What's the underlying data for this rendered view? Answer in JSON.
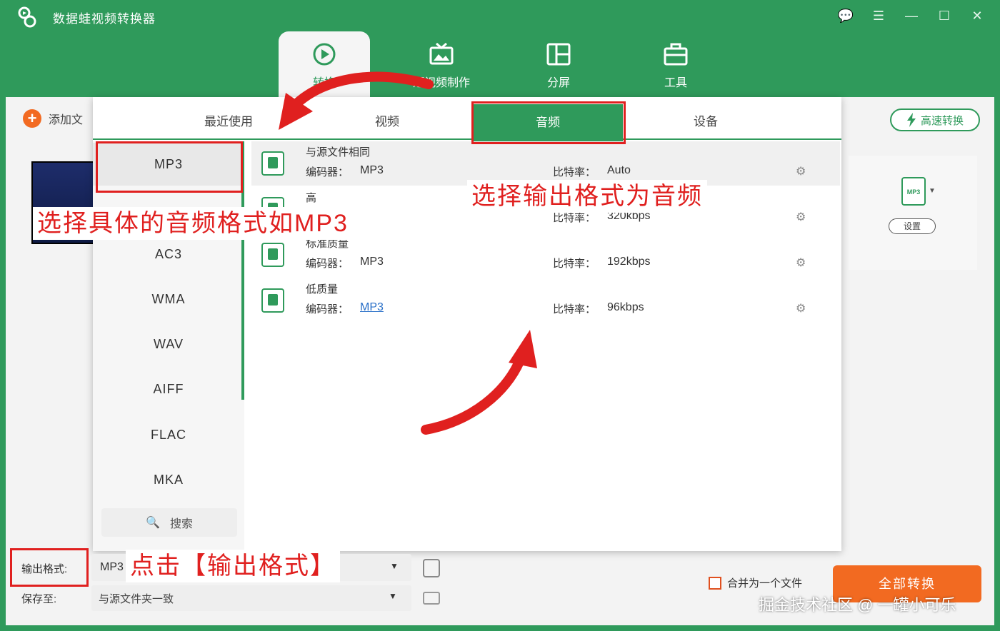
{
  "app": {
    "title": "数据蛙视频转换器"
  },
  "window_controls": [
    {
      "name": "feedback-icon",
      "glyph": "💬"
    },
    {
      "name": "menu-icon",
      "glyph": "☰"
    },
    {
      "name": "minimize-icon",
      "glyph": "—"
    },
    {
      "name": "maximize-icon",
      "glyph": "☐"
    },
    {
      "name": "close-icon",
      "glyph": "✕"
    }
  ],
  "nav": {
    "tabs": [
      {
        "label": "转换",
        "icon": "convert-icon",
        "active": true
      },
      {
        "label": "短视频制作",
        "icon": "short-video-icon",
        "active": false
      },
      {
        "label": "分屏",
        "icon": "split-screen-icon",
        "active": false
      },
      {
        "label": "工具",
        "icon": "toolbox-icon",
        "active": false
      }
    ]
  },
  "toolbar": {
    "add_file": "添加文",
    "fast_convert": "高速转换",
    "settings": "设置"
  },
  "output_icon": {
    "file_label": "MP3"
  },
  "format_panel": {
    "tabs": [
      "最近使用",
      "视频",
      "音频",
      "设备"
    ],
    "active_tab": "音频",
    "formats": [
      "MP3",
      "",
      "",
      "AC3",
      "WMA",
      "WAV",
      "AIFF",
      "FLAC",
      "MKA"
    ],
    "selected_format": "MP3",
    "search": "搜索",
    "codec_label": "编码器：",
    "bitrate_label": "比特率：",
    "presets": [
      {
        "name": "与源文件相同",
        "codec": "MP3",
        "bitrate": "Auto"
      },
      {
        "name": "高",
        "codec": "",
        "bitrate": "320kbps"
      },
      {
        "name": "标准质量",
        "codec": "MP3",
        "bitrate": "192kbps"
      },
      {
        "name": "低质量",
        "codec": "MP3",
        "bitrate": "96kbps"
      }
    ]
  },
  "bottom": {
    "output_format_label": "输出格式:",
    "output_format_value": "MP3",
    "save_to_label": "保存至:",
    "save_to_value": "与源文件夹一致",
    "merge_label": "合并为一个文件",
    "convert_all": "全部转换"
  },
  "annotations": {
    "pick_specific": "选择具体的音频格式如MP3",
    "pick_audio": "选择输出格式为音频",
    "click_output": "点击【输出格式】"
  },
  "watermark": "掘金技术社区 @ 一罐小可乐",
  "colors": {
    "brand_green": "#2f9a5b",
    "accent_orange": "#f26a21",
    "annotation_red": "#e0201f"
  }
}
